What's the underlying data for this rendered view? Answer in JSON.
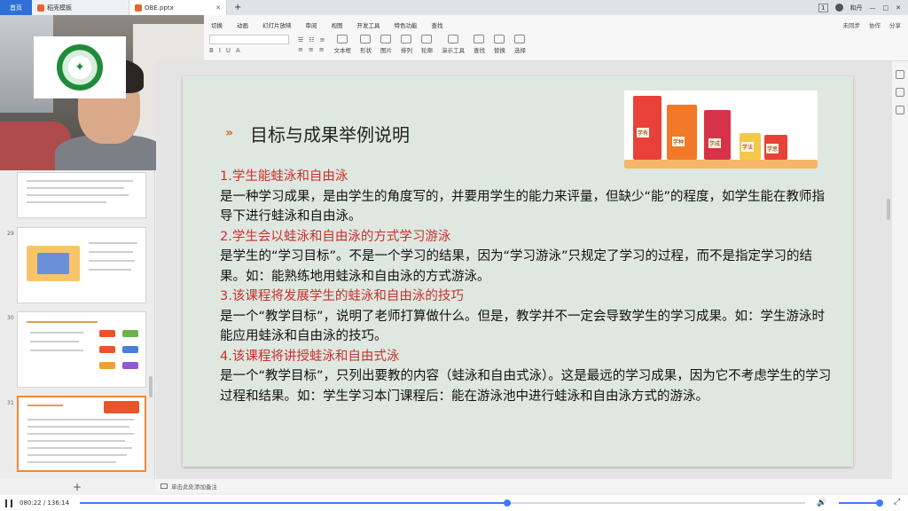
{
  "tabbar": {
    "home_label": "首页",
    "tabs": [
      {
        "label": "稻壳模板",
        "active": false
      },
      {
        "label": "OBE.pptx",
        "active": true
      }
    ],
    "right_badge": "1",
    "user": "和丹"
  },
  "ribbon": {
    "menu": [
      "切换",
      "动画",
      "幻灯片放映",
      "审阅",
      "视图",
      "开发工具",
      "特色功能",
      "查找"
    ],
    "menu_right": [
      "未同步",
      "协作",
      "分享"
    ],
    "tools": [
      "文本框",
      "形状",
      "图片",
      "排列",
      "轮廓",
      "演示工具",
      "替换",
      "选择",
      "查找"
    ]
  },
  "slide": {
    "title": "目标与成果举例说明",
    "book_labels": [
      "学有",
      "学种",
      "学成",
      "学法",
      "学思"
    ],
    "paragraphs": [
      {
        "heading": "1.学生能蛙泳和自由泳",
        "body": "是一种学习成果，是由学生的角度写的，并要用学生的能力来评量，但缺少“能”的程度，如学生能在教师指导下进行蛙泳和自由泳。"
      },
      {
        "heading": "2.学生会以蛙泳和自由泳的方式学习游泳",
        "body": "是学生的“学习目标”。不是一个学习的结果，因为“学习游泳”只规定了学习的过程，而不是指定学习的结果。如：能熟练地用蛙泳和自由泳的方式游泳。"
      },
      {
        "heading": "3.该课程将发展学生的蛙泳和自由泳的技巧",
        "body": "是一个“教学目标”，说明了老师打算做什么。但是，教学并不一定会导致学生的学习成果。如：学生游泳时能应用蛙泳和自由泳的技巧。"
      },
      {
        "heading": "4.该课程将讲授蛙泳和自由式泳",
        "body": "是一个“教学目标”，只列出要教的内容（蛙泳和自由式泳）。这是最远的学习成果，因为它不考虑学生的学习过程和结果。如：学生学习本门课程后：能在游泳池中进行蛙泳和自由泳方式的游泳。"
      }
    ]
  },
  "thumbs": {
    "numbers": [
      "29",
      "30",
      "31"
    ]
  },
  "notes": {
    "placeholder": "单击此处添加备注"
  },
  "player": {
    "time": "080:22 / 136:14",
    "progress": 0.589,
    "volume": 0.95
  }
}
